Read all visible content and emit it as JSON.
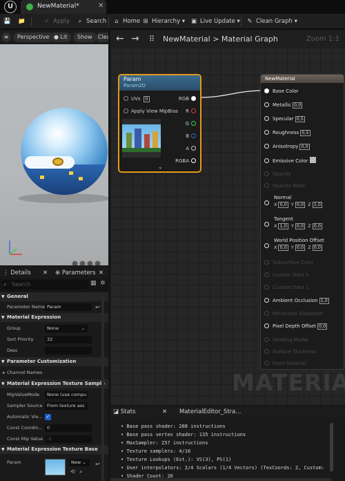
{
  "window": {
    "tab_title": "NewMaterial*"
  },
  "toolbar": {
    "apply": "Apply",
    "search": "Search",
    "home": "Home",
    "hierarchy": "Hierarchy",
    "live_update": "Live Update",
    "clean_graph": "Clean Graph"
  },
  "viewport": {
    "perspective": "Perspective",
    "lit": "Lit",
    "show": "Show",
    "clear": "Clea"
  },
  "graph": {
    "breadcrumb_root": "NewMaterial",
    "breadcrumb_sep": ">",
    "breadcrumb_leaf": "Material Graph",
    "zoom": "Zoom 1:1",
    "watermark": "MATERIAL"
  },
  "param_node": {
    "title": "Param",
    "subtitle": "Param2D",
    "uvs_label": "UVs",
    "uvs_value": "0",
    "apply_mip": "Apply View MipBias",
    "outputs": [
      {
        "label": "RGB",
        "color": "#ffffff"
      },
      {
        "label": "R",
        "color": "#e33b3b"
      },
      {
        "label": "G",
        "color": "#3fd14a"
      },
      {
        "label": "B",
        "color": "#3b66e3"
      },
      {
        "label": "A",
        "color": "#c8c8c8"
      },
      {
        "label": "RGBA",
        "color": "#ffffff"
      }
    ]
  },
  "material_node": {
    "title": "NewMaterial",
    "base_color": "Base Color",
    "metallic": "Metallic",
    "metallic_val": "0,0",
    "specular": "Specular",
    "specular_val": "0,5",
    "roughness": "Roughness",
    "roughness_val": "0,5",
    "anisotropy": "Anisotropy",
    "anisotropy_val": "0,0",
    "emissive": "Emissive Color",
    "opacity": "Opacity",
    "opacity_mask": "Opacity Mask",
    "normal": "Normal",
    "normal_x": "0,0",
    "normal_y": "0,0",
    "normal_z": "1,0",
    "tangent": "Tangent",
    "tangent_x": "1,0",
    "tangent_y": "0,0",
    "tangent_z": "0,0",
    "wpo": "World Position Offset",
    "wpo_x": "0,0",
    "wpo_y": "0,0",
    "wpo_z": "0,0",
    "subsurface": "Subsurface Color",
    "custom0": "Custom Data 0",
    "custom1": "Custom Data 1",
    "ao": "Ambient Occlusion",
    "ao_val": "1,0",
    "refraction": "Refraction (Disabled)",
    "pdo": "Pixel Depth Offset",
    "pdo_val": "0,0",
    "shading": "Shading Model",
    "thickness": "Surface Thickness",
    "front": "Front Material"
  },
  "details": {
    "tab_details": "Details",
    "tab_parameters": "Parameters",
    "search_placeholder": "Search",
    "cat_general": "General",
    "param_name_label": "Parameter Name",
    "param_name_value": "Param",
    "cat_material_expression": "Material Expression",
    "group_label": "Group",
    "group_value": "None",
    "sort_label": "Sort Priority",
    "sort_value": "32",
    "desc_label": "Desc",
    "cat_param_custom": "Parameter Customization",
    "channel_names": "Channel Names",
    "cat_tex_sample": "Material Expression Texture Sample",
    "mip_mode_label": "MipValueMode",
    "mip_mode_value": "None (use compu",
    "sampler_src_label": "Sampler Source",
    "sampler_src_value": "From texture ass",
    "auto_view_label": "Automatic Vie...",
    "const_coord_label": "Const Coordin...",
    "const_coord_value": "0",
    "const_mip_label": "Const Mip Value",
    "const_mip_value": "-1",
    "cat_tex_base": "Material Expression Texture Base",
    "param_label": "Param",
    "param_new": "New"
  },
  "stats": {
    "tab_stats": "Stats",
    "tab_strata": "MaterialEditor_Stra...",
    "lines": [
      "Base pass shader: 208 instructions",
      "Base pass vertex shader: 135 instructions",
      "MaxSampler: 257 instructions",
      "Texture samplers: 4/16",
      "Texture Lookups (Est.): VS(3), PS(1)",
      "User interpolators: 2/4 Scalars (1/4 Vectors) (TexCoords: 2, Custom:",
      "Shader Count: 20"
    ]
  }
}
